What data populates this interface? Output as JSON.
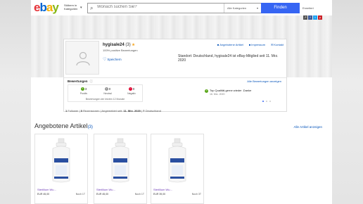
{
  "header": {
    "logo": [
      "e",
      "b",
      "a",
      "y"
    ],
    "logo_colors": [
      "#e53238",
      "#0064d2",
      "#f5af02",
      "#86b817"
    ],
    "category_button_line1": "Stöbern in",
    "category_button_line2": "Kategorien",
    "search_placeholder": "Wonach suchen Sie?",
    "search_category": "Alle Kategorien",
    "find_button": "Finden",
    "advanced_link": "Erweitert"
  },
  "social_icons": [
    "share-icon",
    "facebook-icon",
    "twitter-icon",
    "pinterest-icon"
  ],
  "profile": {
    "username": "hygisale24",
    "score": "(3)",
    "positive_text": "100% positive Bewertungen",
    "save_label": "Speichern",
    "links": [
      "Angebotene Artikel",
      "Impressum",
      "Kontakt"
    ],
    "location_text": "Standort: Deutschland, hygisale24 ist eBay-Mitglied seit 11. Mrz. 2020"
  },
  "ratings": {
    "title": "Bewertungen",
    "all_link": "Alle Bewertungen anzeigen",
    "positive": {
      "count": "3",
      "label": "Positiv",
      "color": "#5ba71b"
    },
    "neutral": {
      "count": "0",
      "label": "Neutral",
      "color": "#999999"
    },
    "negative": {
      "count": "0",
      "label": "Negativ",
      "color": "#e0103a"
    },
    "period": "Bewertungen der letzten 12 Monate",
    "comment": "Top Qualität,gerne wieder .Danke",
    "comment_date": "16. Mrz. 2020"
  },
  "stats": {
    "followers_count": "1",
    "followers_label": "Follower",
    "reviews_count": "0",
    "reviews_label": "Rezensionen",
    "member_label": "Angemeldet seit:",
    "member_date": "11. Mrz. 2020",
    "country": "Deutschland"
  },
  "items_section": {
    "title": "Angebotene Artikel",
    "count": "(3)",
    "all_link": "Alle Artikel anzeigen",
    "items": [
      {
        "title": "Sterillium Wu...",
        "price": "EUR 45,00",
        "time": "Noch 1T"
      },
      {
        "title": "Sterillium Wu...",
        "price": "EUR 45,00",
        "time": "Noch 1T"
      },
      {
        "title": "Sterillium Wu...",
        "price": "EUR 39,00",
        "time": "Noch 3T"
      }
    ]
  }
}
